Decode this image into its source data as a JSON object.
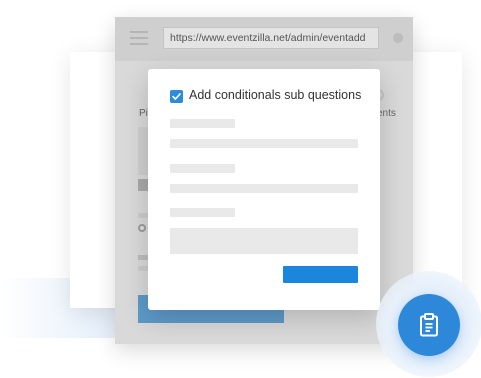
{
  "browser": {
    "url": "https://www.eventzilla.net/admin/eventadd"
  },
  "background_page": {
    "left_fragment": "Pi",
    "right_fragment": "ents"
  },
  "modal": {
    "checkbox_label": "Add conditionals sub questions",
    "checkbox_checked": true
  },
  "fab": {
    "icon": "clipboard-icon"
  },
  "colors": {
    "accent": "#1b86dc",
    "checkbox": "#2f8ad8",
    "fab": "#2d88da",
    "overlay": "#d9d9d9"
  }
}
